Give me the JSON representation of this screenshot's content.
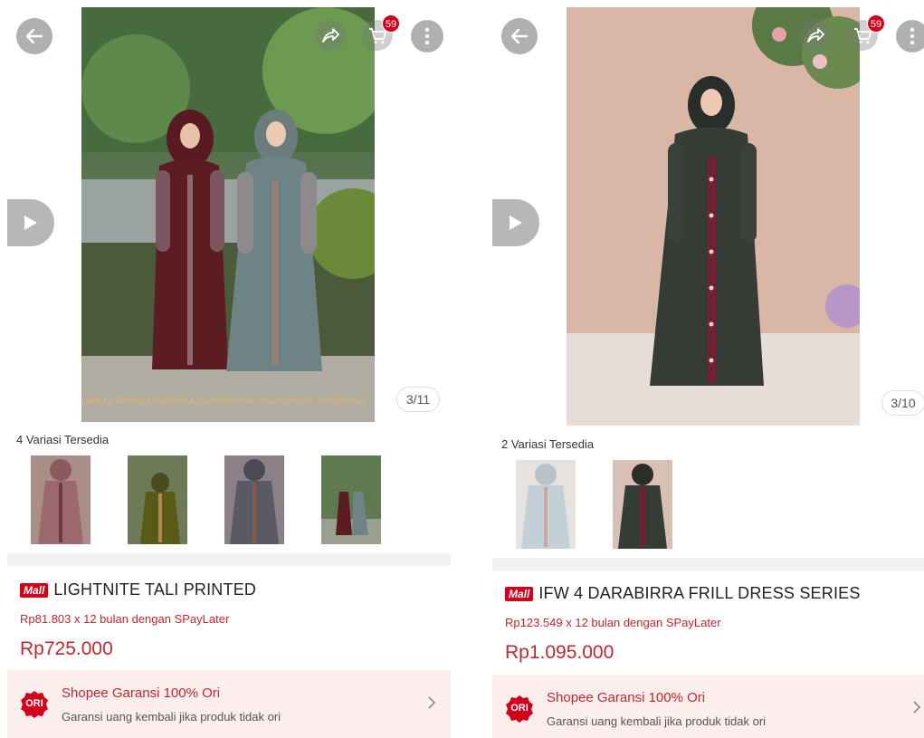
{
  "colors": {
    "accent": "#c1272d",
    "mall_red": "#d0011b",
    "guarantee_bg": "#fdeeee"
  },
  "panels": [
    {
      "cart_count": "59",
      "image_counter": "3/11",
      "variant_label": "4 Variasi Tersedia",
      "watermark": "DARABIRRADARABIRRADARABIRRADARABIRRADARABIRRA",
      "mall_badge": "Mall",
      "title": "LIGHTNITE TALI PRINTED",
      "paylater": "Rp81.803 x 12 bulan dengan SPayLater",
      "price": "Rp725.000",
      "guarantee_title": "Shopee Garansi 100% Ori",
      "guarantee_sub": "Garansi uang kembali jika produk tidak ori",
      "ori_badge": "ORI"
    },
    {
      "cart_count": "59",
      "image_counter": "3/10",
      "variant_label": "2 Variasi Tersedia",
      "mall_badge": "Mall",
      "title": "IFW 4 DARABIRRA FRILL DRESS SERIES",
      "paylater": "Rp123.549 x 12 bulan dengan SPayLater",
      "price": "Rp1.095.000",
      "guarantee_title": "Shopee Garansi 100% Ori",
      "guarantee_sub": "Garansi uang kembali jika produk tidak ori",
      "ori_badge": "ORI"
    }
  ],
  "icons": [
    "back-arrow-icon",
    "share-icon",
    "cart-icon",
    "more-vertical-icon",
    "play-icon",
    "chevron-right-icon",
    "ori-badge-icon"
  ]
}
